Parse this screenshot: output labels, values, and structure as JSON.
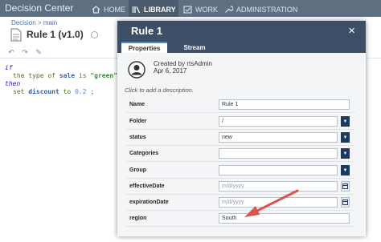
{
  "app": {
    "brand": "Decision Center",
    "nav": [
      {
        "label": "HOME",
        "icon": "home-icon"
      },
      {
        "label": "LIBRARY",
        "icon": "library-icon",
        "active": true
      },
      {
        "label": "WORK",
        "icon": "work-icon"
      },
      {
        "label": "ADMINISTRATION",
        "icon": "wrench-icon"
      }
    ]
  },
  "breadcrumb": {
    "root": "Decision",
    "sep": ">",
    "branch": "main"
  },
  "page": {
    "title": "Rule 1 (v1.0)"
  },
  "code": {
    "if_kw": "if",
    "line1_a": "the type of ",
    "line1_var": "sale",
    "line1_b": " is ",
    "line1_str": "\"green\"",
    "then_kw": "then",
    "line2_a": "set ",
    "line2_var": "discount",
    "line2_b": " to ",
    "line2_num": "0.2",
    "line2_c": " ;"
  },
  "modal": {
    "title": "Rule 1",
    "close": "✕",
    "tabs": [
      "Properties",
      "Stream"
    ],
    "created_by": "Created by rtsAdmin",
    "created_date": "Apr 6, 2017",
    "description_hint": "Click to add a description.",
    "properties": [
      {
        "label": "Name",
        "value": "Rule 1",
        "kind": "text"
      },
      {
        "label": "Folder",
        "value": "/",
        "kind": "select"
      },
      {
        "label": "status",
        "value": "new",
        "kind": "select"
      },
      {
        "label": "Categories",
        "value": "",
        "kind": "select"
      },
      {
        "label": "Group",
        "value": "",
        "kind": "select"
      },
      {
        "label": "effectiveDate",
        "placeholder": "m/d/yyyy",
        "kind": "date"
      },
      {
        "label": "expirationDate",
        "placeholder": "m/d/yyyy",
        "kind": "date"
      },
      {
        "label": "region",
        "value": "South",
        "kind": "text"
      }
    ]
  },
  "colors": {
    "topbar": "#5f6f82",
    "modal_header": "#3c4f66",
    "dropdown_button": "#1c3a5e",
    "annotation_arrow": "#d9534f"
  }
}
